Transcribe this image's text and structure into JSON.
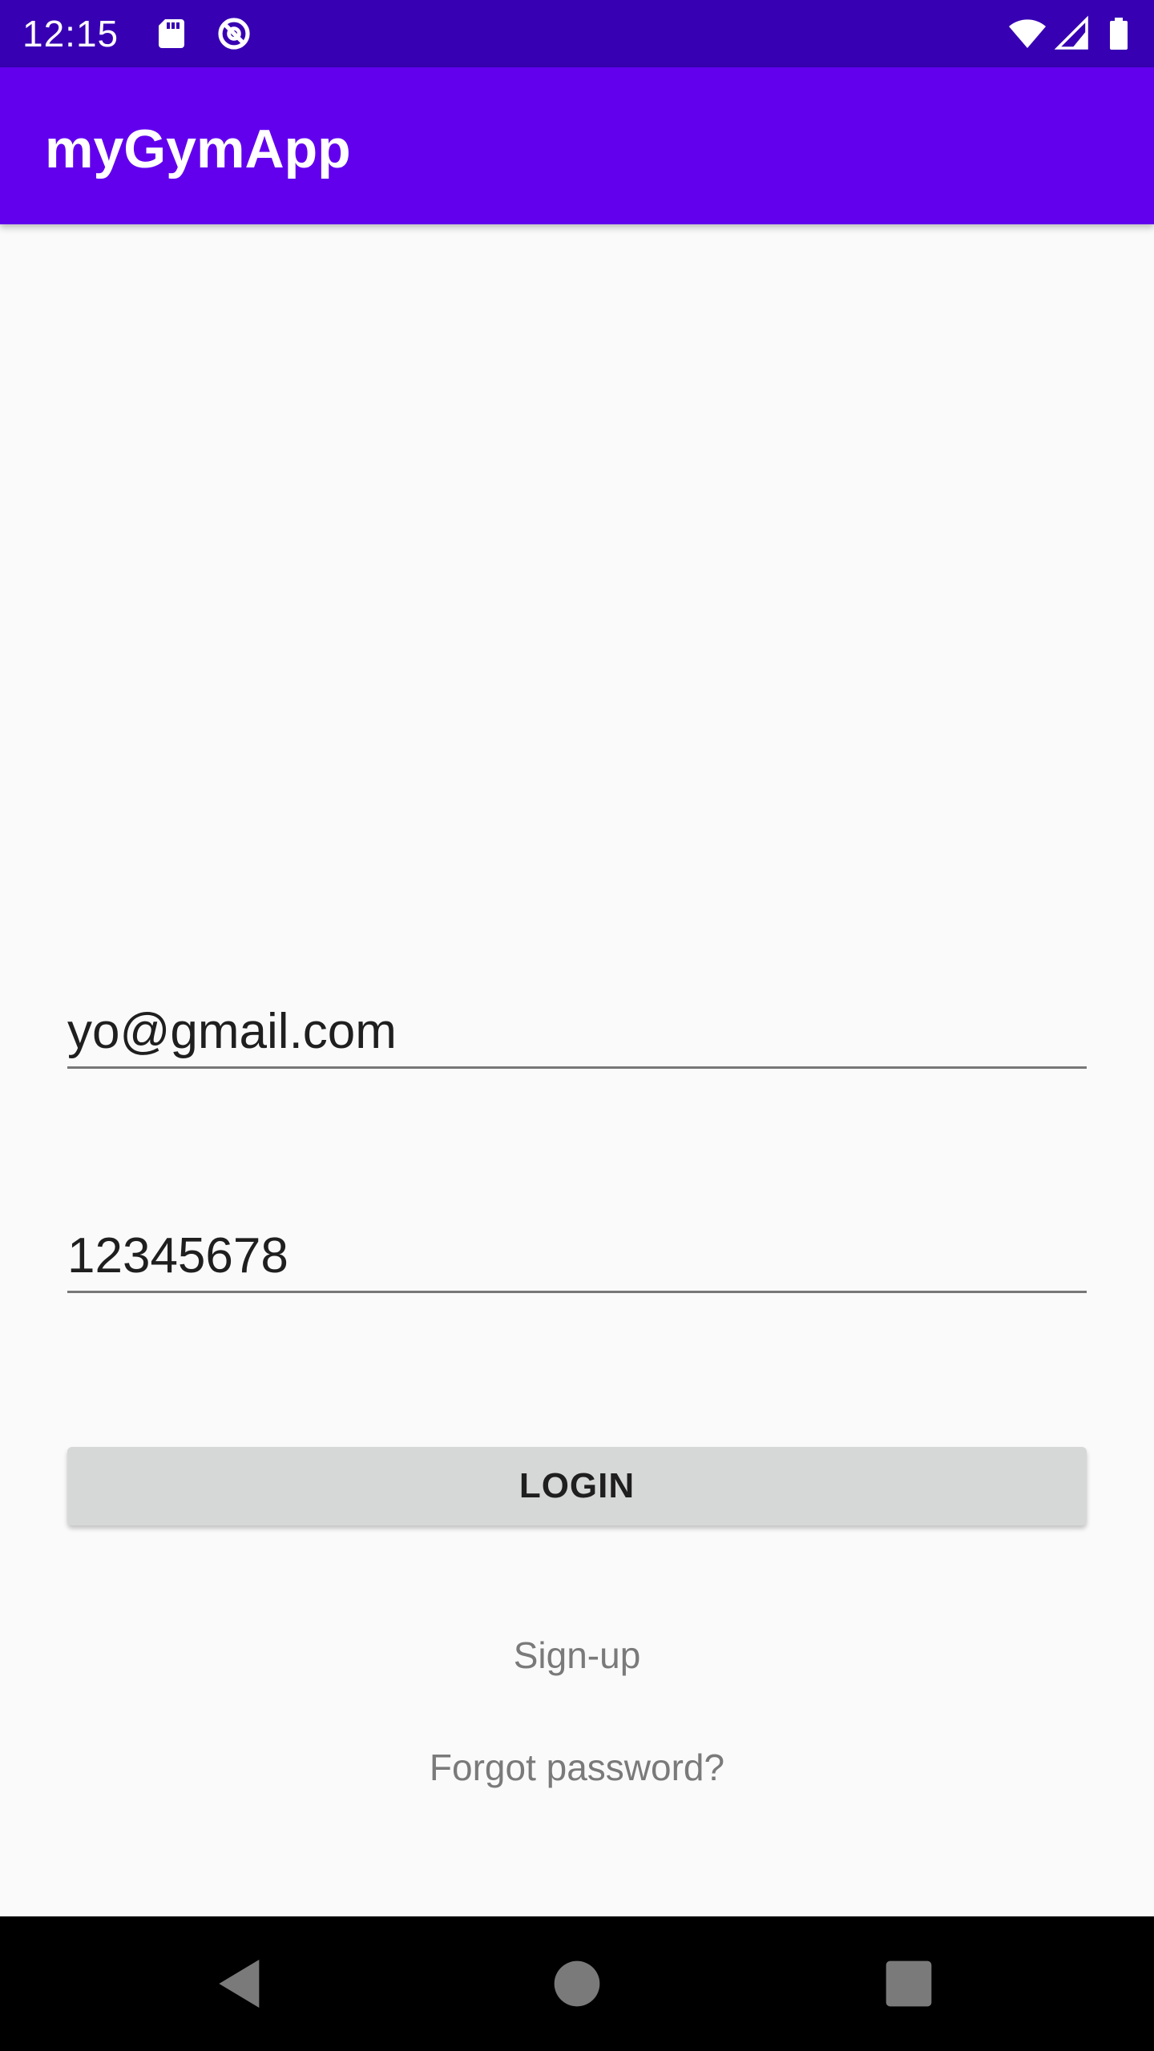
{
  "status_bar": {
    "time": "12:15",
    "icons": [
      "sd-card-icon",
      "data-saver-icon",
      "wifi-icon",
      "cellular-signal-icon",
      "battery-icon"
    ],
    "background_color": "#3700b3"
  },
  "app_bar": {
    "title": "myGymApp",
    "background_color": "#6200ee"
  },
  "form": {
    "email_value": "yo@gmail.com",
    "password_value": "12345678",
    "login_label": "LOGIN",
    "signup_label": "Sign-up",
    "forgot_label": "Forgot password?"
  },
  "nav_bar": {
    "icons": [
      "back-icon",
      "home-icon",
      "recents-icon"
    ]
  }
}
